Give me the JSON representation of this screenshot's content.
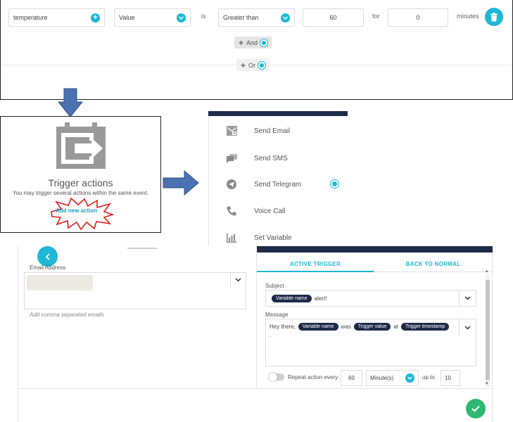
{
  "condition": {
    "variable": "temperature",
    "value_select": "Value",
    "is_label": "is",
    "operator": "Greater than",
    "threshold": "60",
    "for_label": "for",
    "duration": "0",
    "minutes_label": "minutes",
    "and_label": "And",
    "or_label": "Or"
  },
  "trigger_actions": {
    "title": "Trigger actions",
    "subtitle": "You may trigger several actions within the same event.",
    "add_label": "Add new action"
  },
  "actions": [
    {
      "label": "Send Email",
      "icon": "email-icon"
    },
    {
      "label": "Send SMS",
      "icon": "sms-icon"
    },
    {
      "label": "Send Telegram",
      "icon": "telegram-icon"
    },
    {
      "label": "Voice Call",
      "icon": "phone-icon"
    },
    {
      "label": "Set Variable",
      "icon": "bar-chart-icon"
    }
  ],
  "email_form": {
    "email_label": "Email Address",
    "email_hint": "Add comma separated emails",
    "tabs": {
      "active": "ACTIVE TRIGGER",
      "back": "BACK TO NORMAL"
    },
    "subject_label": "Subject",
    "subject_tag": "Variable name",
    "subject_text": "alert!",
    "message_label": "Message",
    "message_prefix": "Hey there,",
    "message_tag1": "Variable name",
    "message_was": "was",
    "message_tag2": "Trigger value",
    "message_at": "at",
    "message_tag3": "Trigger timestamp",
    "message_end": ".",
    "repeat_label": "Repeat action every",
    "repeat_value": "60",
    "repeat_unit": "Minute(s)",
    "upto_label": "up to",
    "upto_value": "10"
  },
  "colors": {
    "accent": "#1cb8d6",
    "navy": "#1e2a4a",
    "arrow": "#4a72b3",
    "green": "#2eb873",
    "starburst_red": "#e01b1b"
  }
}
